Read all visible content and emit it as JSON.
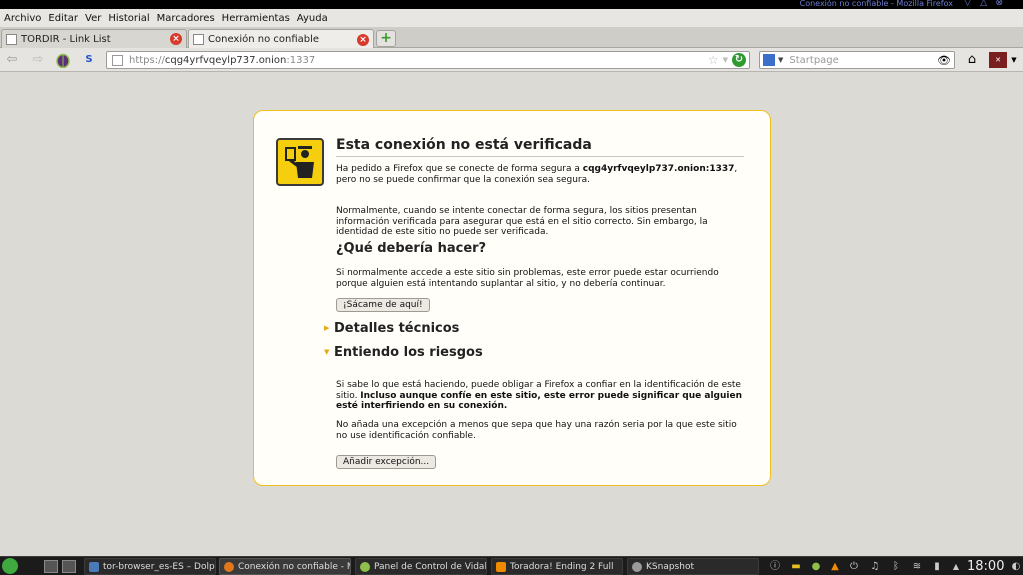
{
  "window": {
    "title": "Conexión no confiable - Mozilla Firefox"
  },
  "menu": [
    "Archivo",
    "Editar",
    "Ver",
    "Historial",
    "Marcadores",
    "Herramientas",
    "Ayuda"
  ],
  "tabs": [
    {
      "label": "TORDIR - Link List"
    },
    {
      "label": "Conexión no confiable"
    }
  ],
  "nav": {
    "url_scheme": "https://",
    "url_host": "cqg4yrfvqeylp737.onion",
    "url_port": ":1337",
    "search_placeholder": "Startpage"
  },
  "error": {
    "title": "Esta conexión no está verificada",
    "p1_pre": "Ha pedido a Firefox que se conecte de forma segura a ",
    "p1_host": "cqg4yrfvqeylp737.onion:1337",
    "p1_post": ", pero no se puede confirmar que la conexión sea segura.",
    "p2": "Normalmente, cuando se intente conectar de forma segura, los sitios presentan información verificada para asegurar que está en el sitio correcto. Sin embargo, la identidad de este sitio no puede ser verificada.",
    "what_heading": "¿Qué debería hacer?",
    "p3": "Si normalmente accede a este sitio sin problemas, este error puede estar ocurriendo porque alguien está intentando suplantar al sitio, y no debería continuar.",
    "get_out_button": "¡Sácame de aquí!",
    "technical_label": "Detalles técnicos",
    "risks_label": "Entiendo los riesgos",
    "p4_pre": "Si sabe lo que está haciendo, puede obligar a Firefox a confiar en la identificación de este sitio. ",
    "p4_bold": "Incluso aunque confíe en este sitio, este error puede significar que alguien esté interfiriendo en su conexión.",
    "p5": "No añada una excepción a menos que sepa que hay una razón seria por la que este sitio no use identificación confiable.",
    "add_exception_button": "Añadir excepción..."
  },
  "taskbar": {
    "tasks": [
      {
        "label": "tor-browser_es-ES – Dolp"
      },
      {
        "label": "Conexión no confiable - M"
      },
      {
        "label": "Panel de Control de Vidali"
      },
      {
        "label": "Toradora! Ending 2  Full"
      },
      {
        "label": "KSnapshot"
      }
    ],
    "clock": "18:00"
  },
  "colors": {
    "accent_border": "#f0c020",
    "warning_icon": "#f5cf0e"
  }
}
